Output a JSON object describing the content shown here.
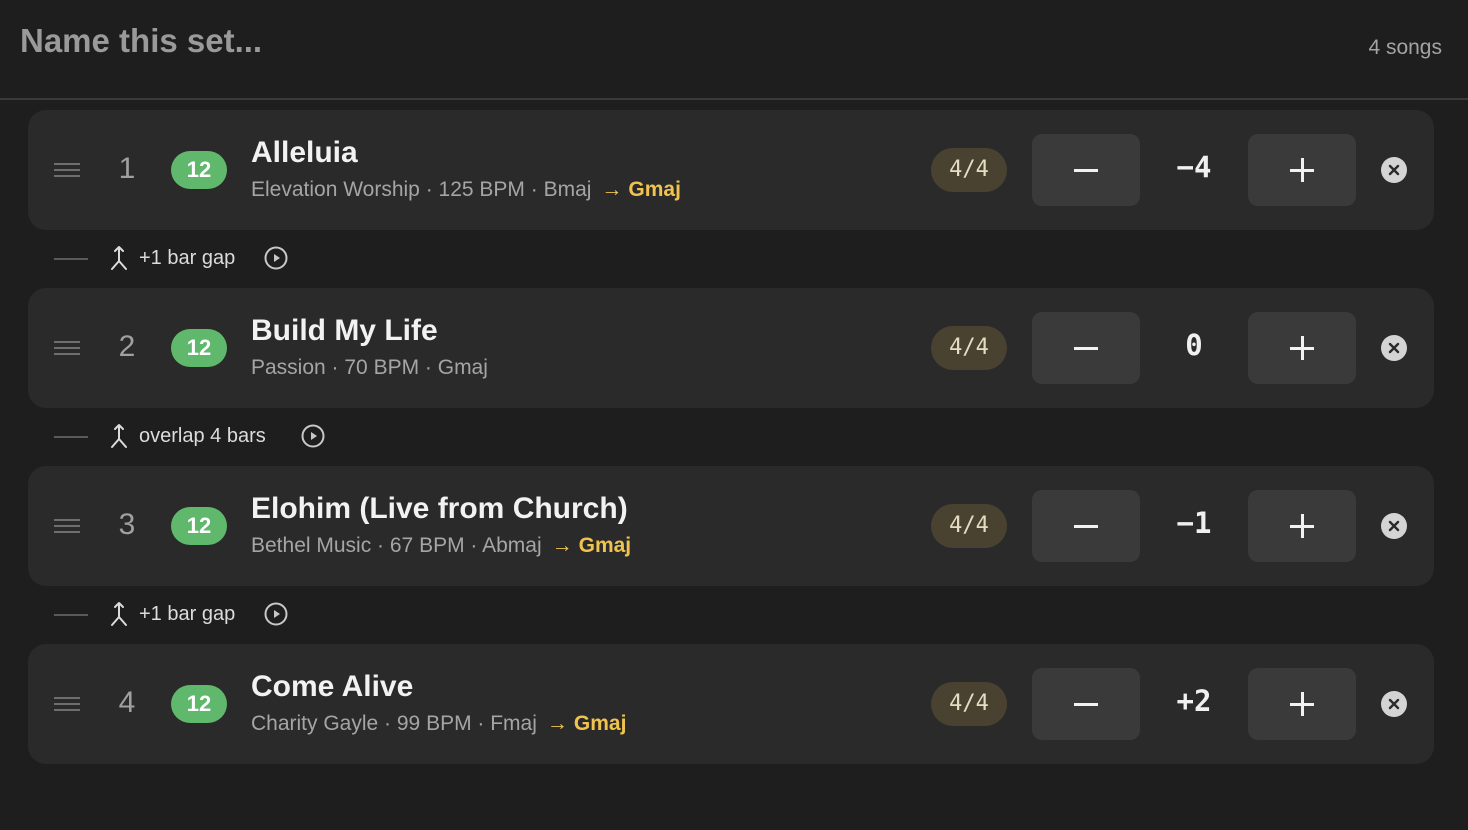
{
  "header": {
    "set_name_placeholder": "Name this set...",
    "song_count": "4 songs"
  },
  "songs": [
    {
      "index": "1",
      "badge": "12",
      "title": "Alleluia",
      "meta": "Elevation Worship · 125 BPM · Bmaj",
      "arrow": "→",
      "target_key": "Gmaj",
      "time_signature": "4/4",
      "transpose": "−4"
    },
    {
      "index": "2",
      "badge": "12",
      "title": "Build My Life",
      "meta": "Passion · 70 BPM · Gmaj",
      "arrow": "",
      "target_key": "",
      "time_signature": "4/4",
      "transpose": "0"
    },
    {
      "index": "3",
      "badge": "12",
      "title": "Elohim (Live from Church)",
      "meta": "Bethel Music · 67 BPM · Abmaj",
      "arrow": "→",
      "target_key": "Gmaj",
      "time_signature": "4/4",
      "transpose": "−1"
    },
    {
      "index": "4",
      "badge": "12",
      "title": "Come Alive",
      "meta": "Charity Gayle · 99 BPM · Fmaj",
      "arrow": "→",
      "target_key": "Gmaj",
      "time_signature": "4/4",
      "transpose": "+2"
    }
  ],
  "transitions": [
    {
      "label": "+1 bar gap"
    },
    {
      "label": "overlap 4 bars"
    },
    {
      "label": "+1 bar gap"
    }
  ],
  "icons": {
    "drag": "drag-handle-icon",
    "minus": "minus-icon",
    "plus": "plus-icon",
    "remove": "close-circle-icon",
    "merge": "merge-icon",
    "play": "play-circle-icon"
  },
  "colors": {
    "background": "#1e1e1e",
    "card": "#2a2a2a",
    "badge_green": "#5fb86c",
    "key_accent": "#f0c34e",
    "time_sig_bg": "#4a4230"
  }
}
